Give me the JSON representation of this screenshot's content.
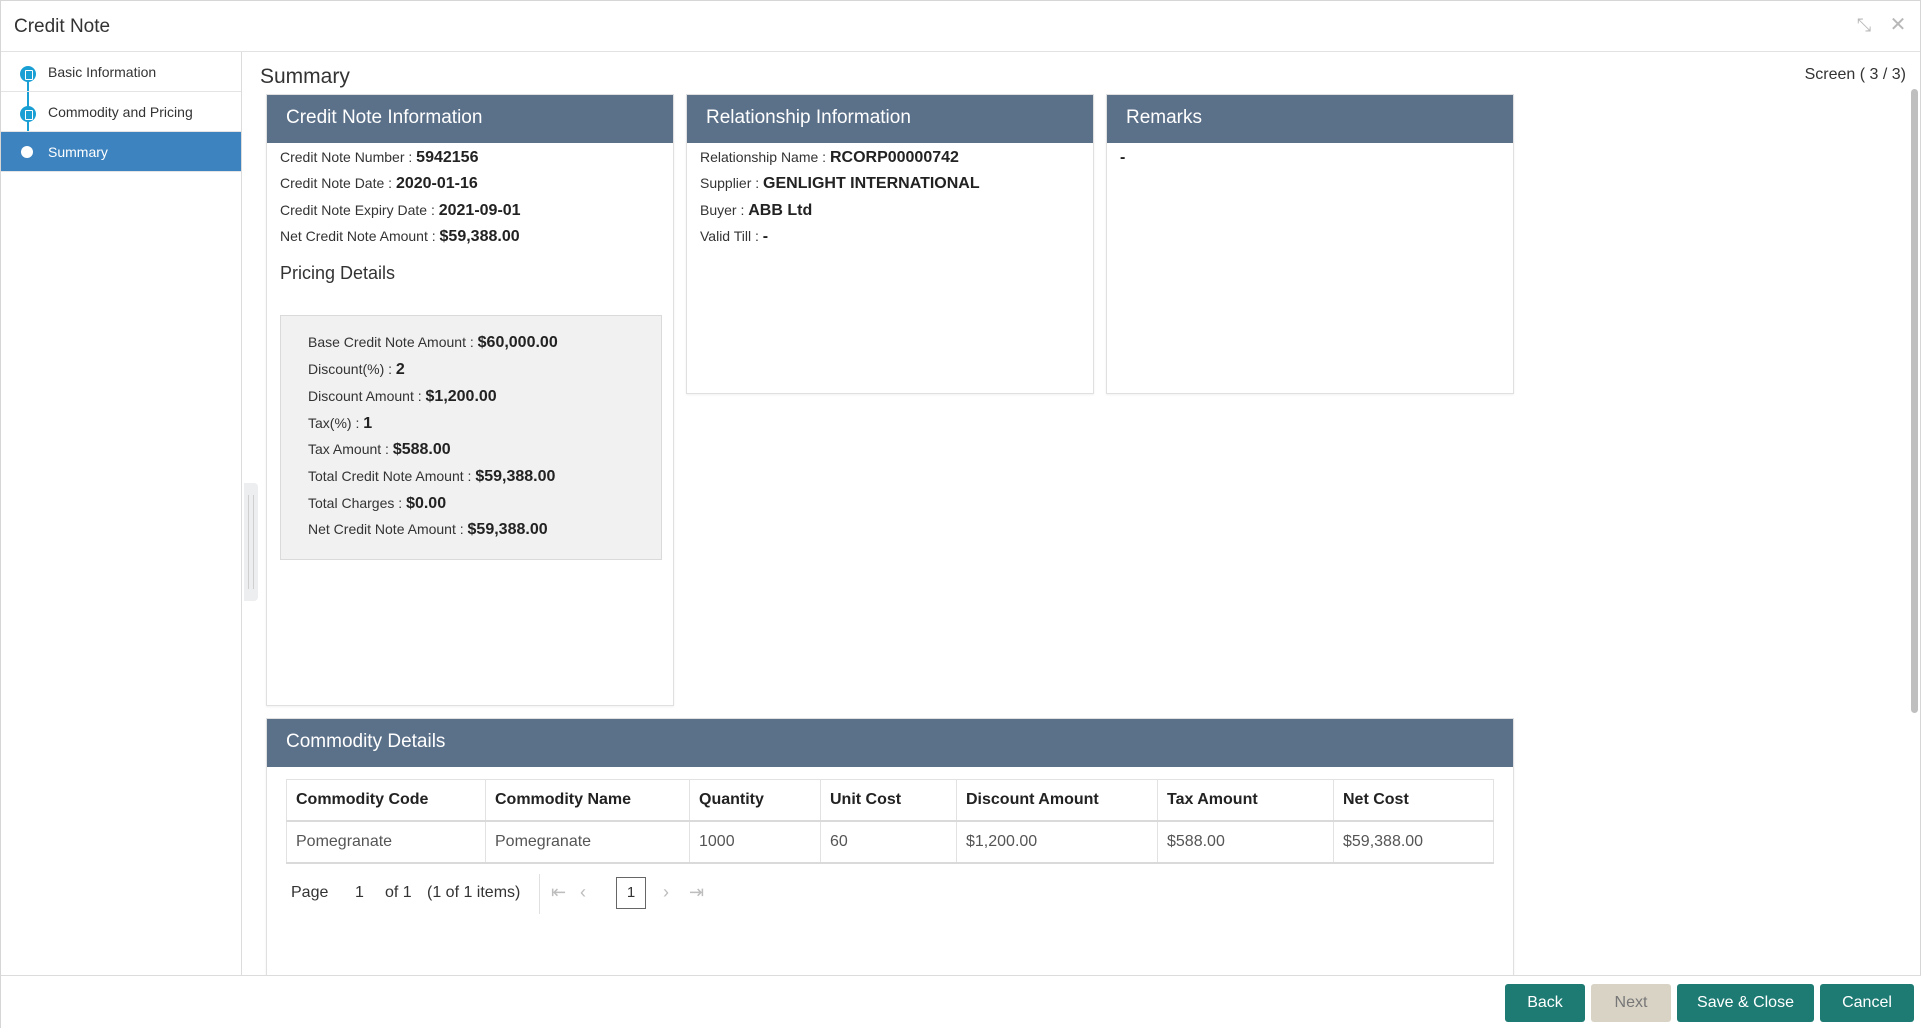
{
  "window": {
    "title": "Credit Note"
  },
  "sidebar": {
    "steps": [
      {
        "label": "Basic Information"
      },
      {
        "label": "Commodity and Pricing"
      },
      {
        "label": "Summary"
      }
    ]
  },
  "main": {
    "title": "Summary",
    "screen_count": "Screen ( 3 / 3)"
  },
  "credit_note_info": {
    "heading": "Credit Note Information",
    "fields": [
      {
        "label": "Credit Note Number : ",
        "value": "5942156"
      },
      {
        "label": "Credit Note Date : ",
        "value": "2020-01-16"
      },
      {
        "label": "Credit Note Expiry Date : ",
        "value": "2021-09-01"
      },
      {
        "label": "Net Credit Note Amount : ",
        "value": "$59,388.00"
      }
    ],
    "pricing_title": "Pricing Details",
    "pricing": [
      {
        "label": "Base Credit Note Amount : ",
        "value": "$60,000.00"
      },
      {
        "label": "Discount(%) : ",
        "value": "2"
      },
      {
        "label": "Discount Amount : ",
        "value": "$1,200.00"
      },
      {
        "label": "Tax(%) : ",
        "value": "1"
      },
      {
        "label": "Tax Amount : ",
        "value": "$588.00"
      },
      {
        "label": "Total Credit Note Amount : ",
        "value": "$59,388.00"
      },
      {
        "label": "Total Charges : ",
        "value": "$0.00"
      },
      {
        "label": "Net Credit Note Amount : ",
        "value": "$59,388.00"
      }
    ]
  },
  "relationship_info": {
    "heading": "Relationship Information",
    "fields": [
      {
        "label": "Relationship Name : ",
        "value": "RCORP00000742"
      },
      {
        "label": "Supplier : ",
        "value": "GENLIGHT INTERNATIONAL"
      },
      {
        "label": "Buyer : ",
        "value": "ABB Ltd"
      },
      {
        "label": "Valid Till : ",
        "value": "-"
      }
    ]
  },
  "remarks": {
    "heading": "Remarks",
    "value": "-"
  },
  "commodity": {
    "heading": "Commodity Details",
    "columns": [
      "Commodity Code",
      "Commodity Name",
      "Quantity",
      "Unit Cost",
      "Discount Amount",
      "Tax Amount",
      "Net Cost"
    ],
    "rows": [
      [
        "Pomegranate",
        "Pomegranate",
        "1000",
        "60",
        " $1,200.00",
        " $588.00",
        " $59,388.00"
      ]
    ],
    "pager": {
      "page_label": "Page",
      "page_value": "1",
      "of_label": "of 1",
      "items_label": "(1 of 1 items)",
      "current": "1"
    }
  },
  "footer": {
    "back": "Back",
    "next": "Next",
    "save_close": "Save & Close",
    "cancel": "Cancel"
  },
  "colors": {
    "accent": "#3d83bf",
    "card_header": "#5b7089",
    "primary_button": "#1e7b74",
    "step_icon": "#1a9fd4"
  }
}
